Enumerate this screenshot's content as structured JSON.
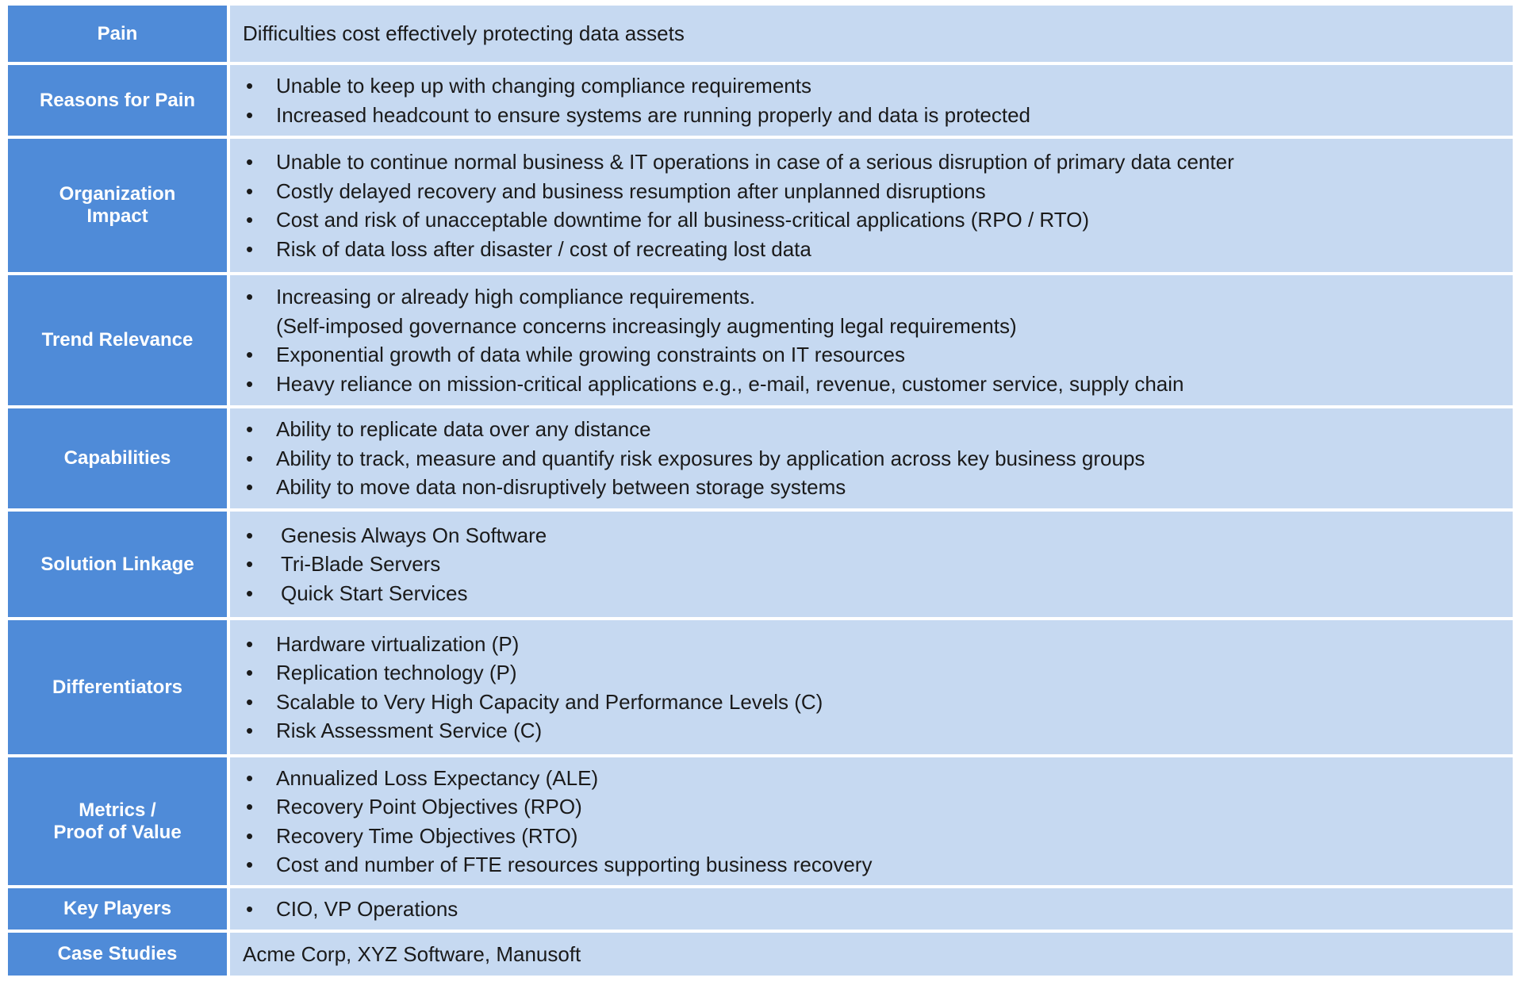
{
  "colors": {
    "label_bg": "#4F8BD8",
    "content_bg": "#C6D9F1",
    "label_text": "#FFFFFF",
    "content_text": "#1A1A1A"
  },
  "rows": [
    {
      "label": "Pain",
      "text": "Difficulties cost effectively protecting data assets"
    },
    {
      "label": "Reasons for Pain",
      "bullets": [
        "Unable to keep up with changing compliance requirements",
        "Increased headcount to ensure systems are running properly and data is protected"
      ]
    },
    {
      "label": "Organization\nImpact",
      "bullets": [
        "Unable to continue normal business & IT operations in case of a serious disruption of primary data center",
        "Costly delayed recovery and business resumption after unplanned disruptions",
        "Cost and risk of unacceptable downtime for all business-critical applications (RPO / RTO)",
        "Risk of data loss after disaster / cost of recreating lost data"
      ]
    },
    {
      "label": "Trend Relevance",
      "bullets": [
        "Increasing or already high compliance requirements.",
        "Exponential growth of data while growing constraints on IT resources",
        "Heavy reliance on mission-critical applications e.g., e-mail, revenue, customer service, supply chain"
      ],
      "continuation": "(Self-imposed governance concerns increasingly augmenting legal requirements)"
    },
    {
      "label": "Capabilities",
      "bullets": [
        "Ability to replicate data over any distance",
        "Ability to track, measure and quantify risk exposures by application across key business groups",
        "Ability to move data non-disruptively between storage systems"
      ]
    },
    {
      "label": "Solution Linkage",
      "bullets": [
        "Genesis Always On Software",
        "Tri-Blade Servers",
        "Quick Start Services"
      ]
    },
    {
      "label": "Differentiators",
      "bullets": [
        "Hardware virtualization (P)",
        "Replication technology (P)",
        "Scalable to Very High Capacity and Performance Levels (C)",
        "Risk Assessment Service (C)"
      ]
    },
    {
      "label": "Metrics /\nProof of Value",
      "bullets": [
        "Annualized Loss Expectancy (ALE)",
        "Recovery Point Objectives (RPO)",
        "Recovery Time Objectives (RTO)",
        "Cost and number of FTE resources supporting business recovery"
      ]
    },
    {
      "label": "Key Players",
      "bullets": [
        "CIO, VP Operations"
      ]
    },
    {
      "label": "Case Studies",
      "text": "Acme Corp, XYZ Software, Manusoft"
    }
  ],
  "bullet_glyph": "•"
}
